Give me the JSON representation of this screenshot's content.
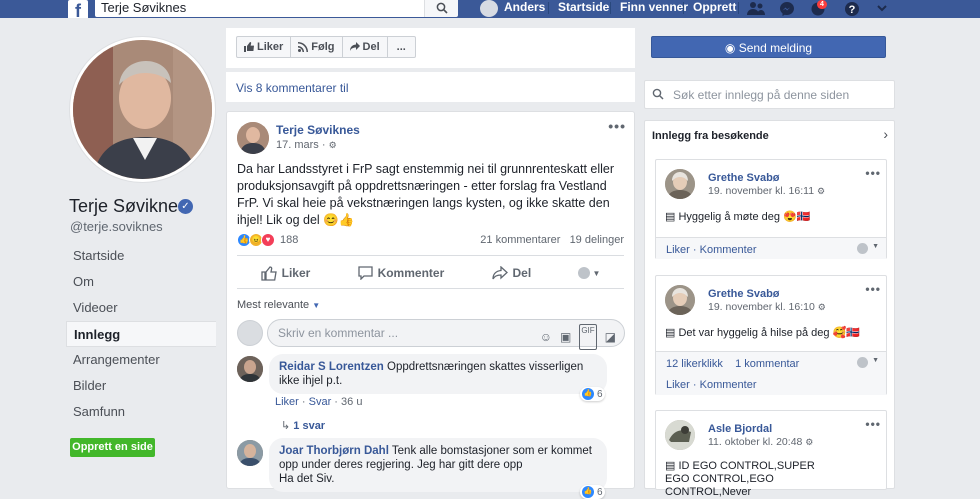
{
  "topbar": {
    "search_value": "Terje Søviknes",
    "user_name": "Anders",
    "nav_home": "Startside",
    "nav_find_friends": "Finn venner",
    "nav_create": "Opprett",
    "notif_count": "4"
  },
  "profile": {
    "name": "Terje Søviknes",
    "handle": "@terje.soviknes",
    "nav": [
      "Startside",
      "Om",
      "Videoer",
      "Innlegg",
      "Arrangementer",
      "Bilder",
      "Samfunn"
    ],
    "active_nav": "Innlegg",
    "create_page": "Opprett en side"
  },
  "actions": {
    "like": "Liker",
    "follow": "Følg",
    "share": "Del",
    "more": "..."
  },
  "more_comments": "Vis 8 kommentarer til",
  "post": {
    "author": "Terje Søviknes",
    "date": "17. mars",
    "text": "Da har Landsstyret i FrP sagt enstemmig nei til grunnrenteskatt eller produksjonsavgift på oppdrettsnæringen - etter forslag fra Vestland FrP. Vi skal heie på vekstnæringen langs kysten, og ikke skatte den ihjel! Lik og del 😊👍",
    "reaction_count": "188",
    "comment_count": "21 kommentarer",
    "share_count": "19 delinger",
    "like_label": "Liker",
    "comment_label": "Kommenter",
    "share_label": "Del",
    "sort_label": "Mest relevante",
    "comment_placeholder": "Skriv en kommentar ..."
  },
  "comments": [
    {
      "name": "Reidar S Lorentzen",
      "text": "Oppdrettsnæringen skattes visserligen ikke ihjel p.t.",
      "like": "Liker",
      "reply": "Svar",
      "age": "36 u",
      "likes": "6",
      "replies": "1 svar"
    },
    {
      "name": "Joar Thorbjørn Dahl",
      "text": "Tenk alle bomstasjoner som er kommet opp under deres regjering. Jeg har gitt dere opp",
      "text2": "Ha det Siv.",
      "likes": "6"
    }
  ],
  "right": {
    "send_message": "Send melding",
    "search_placeholder": "Søk etter innlegg på denne siden",
    "visitor_title": "Innlegg fra besøkende",
    "cards": [
      {
        "name": "Grethe Svabø",
        "date": "19. november kl. 16:11",
        "text": "Hyggelig å møte deg 😍🇳🇴",
        "foot_like": "Liker",
        "foot_comment": "Kommenter"
      },
      {
        "name": "Grethe Svabø",
        "date": "19. november kl. 16:10",
        "text": "Det var hyggelig å hilse på deg 🥰🇳🇴",
        "stats_likes": "12 likerklikk",
        "stats_comments": "1 kommentar",
        "foot_like": "Liker",
        "foot_comment": "Kommenter"
      },
      {
        "name": "Asle Bjordal",
        "date": "11. oktober kl. 20:48",
        "text": "ID EGO CONTROL,SUPER EGO CONTROL,EGO CONTROL,Never"
      }
    ]
  }
}
